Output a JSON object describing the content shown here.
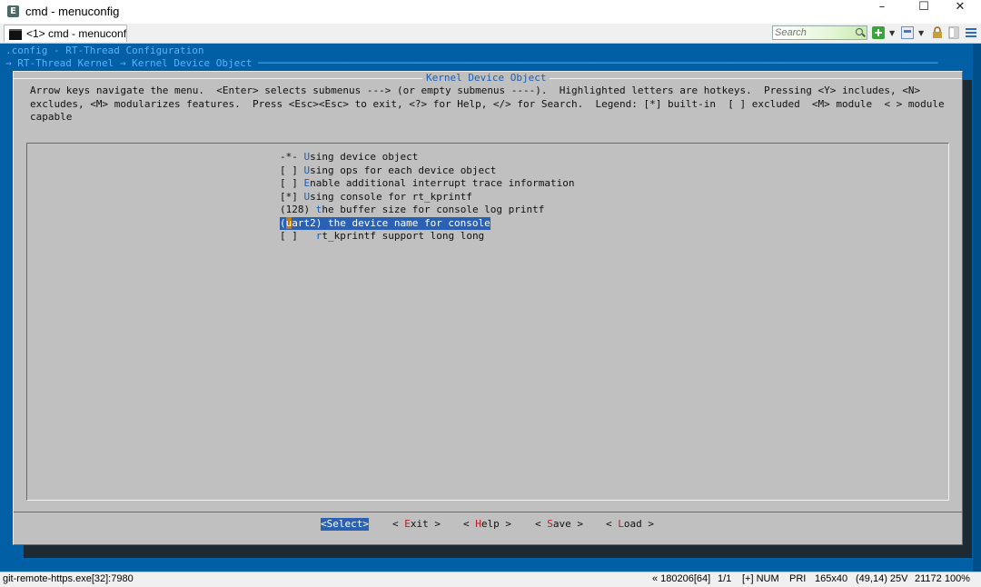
{
  "window": {
    "title": "cmd - menuconfig",
    "app_icon_letter": "E",
    "controls": {
      "minimize": "–",
      "maximize": "☐",
      "close": "✕"
    }
  },
  "tabbar": {
    "active_tab": "<1> cmd - menuconf",
    "search_placeholder": "Search",
    "icons": [
      "terminal-icon",
      "new-console-icon",
      "layout-icon",
      "lock-icon",
      "document-icon",
      "menu-icon"
    ]
  },
  "console": {
    "header_line1": ".config - RT-Thread Configuration",
    "header_line2": "→ RT-Thread Kernel → Kernel Device Object ─────────────────────────────────────────────────────────────────────────────────────────────────────────────────",
    "dialog_title": "Kernel Device Object",
    "help_text": "Arrow keys navigate the menu.  <Enter> selects submenus ---> (or empty submenus ----).  Highlighted letters are hotkeys.  Pressing <Y> includes, <N>\nexcludes, <M> modularizes features.  Press <Esc><Esc> to exit, <?> for Help, </> for Search.  Legend: [*] built-in  [ ] excluded  <M> module  < > module\ncapable",
    "menu_items": [
      {
        "prefix": "-*- ",
        "hotkey": "U",
        "rest": "sing device object"
      },
      {
        "prefix": "[ ] ",
        "hotkey": "U",
        "rest": "sing ops for each device object"
      },
      {
        "prefix": "[ ] ",
        "hotkey": "E",
        "rest": "nable additional interrupt trace information"
      },
      {
        "prefix": "[*] ",
        "hotkey": "U",
        "rest": "sing console for rt_kprintf"
      },
      {
        "prefix": "(128) ",
        "hotkey": "t",
        "rest": "he buffer size for console log printf"
      },
      {
        "prefix": "(",
        "cursor": "u",
        "rest": "art2) the device name for console"
      },
      {
        "prefix": "[ ]   ",
        "hotkey": "r",
        "rest": "t_kprintf support long long"
      }
    ],
    "buttons": {
      "select": {
        "pre": "<",
        "hk": "S",
        "post": "elect>"
      },
      "exit": {
        "pre": "< ",
        "hk": "E",
        "post": "xit >"
      },
      "help": {
        "pre": "< ",
        "hk": "H",
        "post": "elp >"
      },
      "save": {
        "pre": "< ",
        "hk": "S",
        "post": "ave >"
      },
      "load": {
        "pre": "< ",
        "hk": "L",
        "post": "oad >"
      }
    }
  },
  "statusbar": {
    "process": "git-remote-https.exe[32]:7980",
    "build": "« 180206[64]",
    "pages": "1/1",
    "flags": "[+] NUM",
    "priority": "PRI",
    "size": "165x40",
    "cursor_pos": "(49,14) 25V",
    "pid_zoom": "21172 100%"
  },
  "colors": {
    "console_bg": "#005fa5",
    "dialog_bg": "#c0c0c0",
    "highlight": "#2b61b2",
    "hotkey": "#1a5fb4",
    "button_hotkey": "#b02020"
  }
}
